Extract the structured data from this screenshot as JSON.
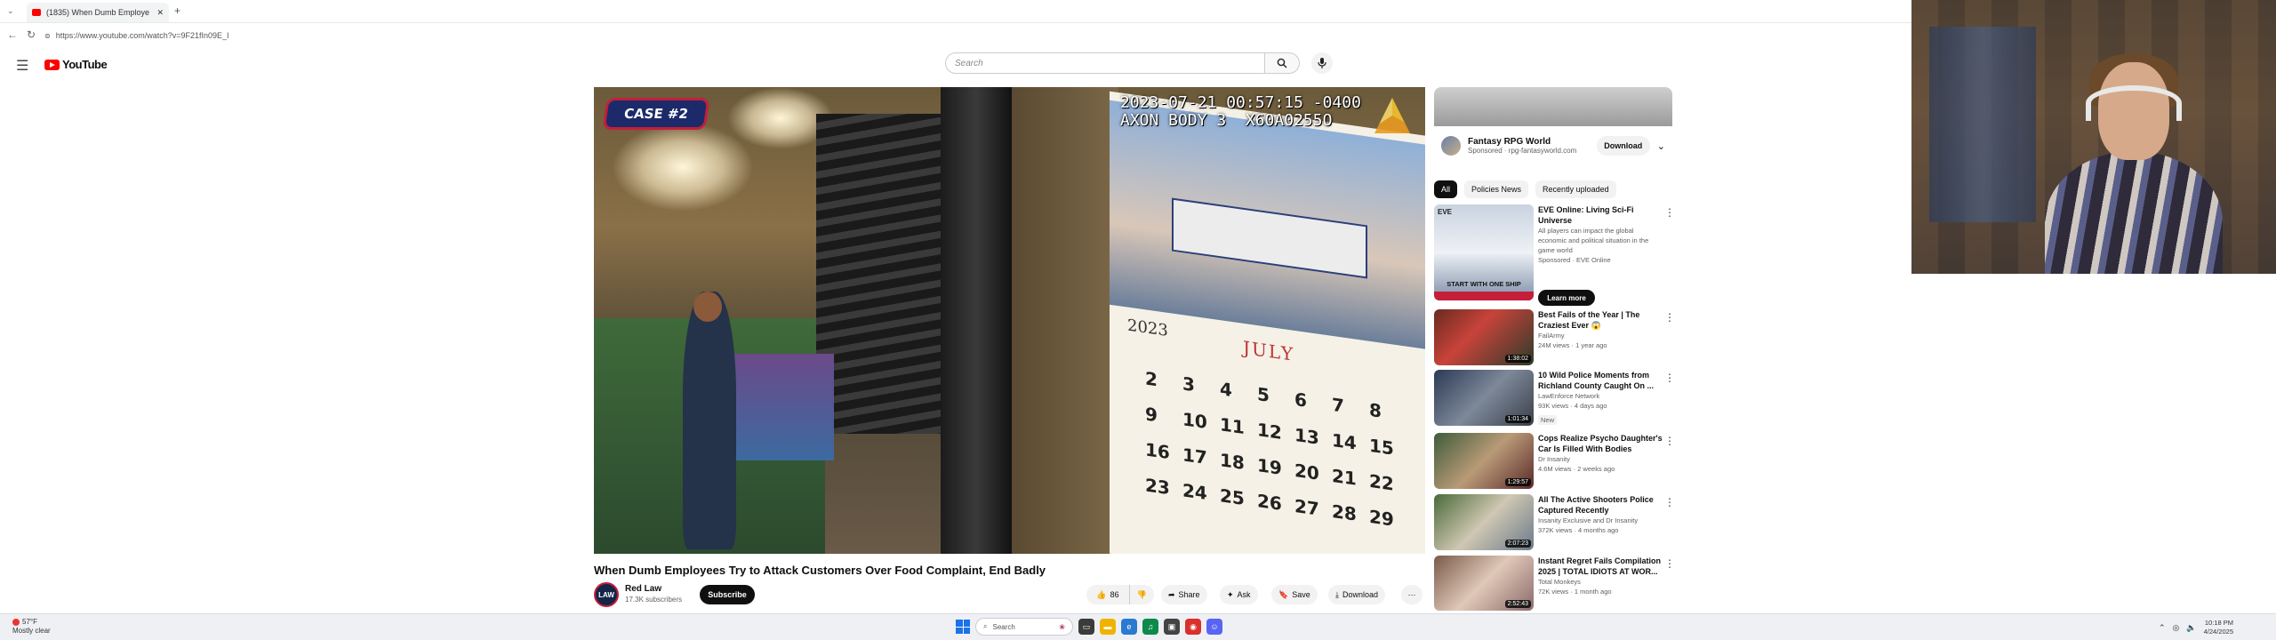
{
  "browser": {
    "tab_title": "(1835) When Dumb Employe",
    "url": "https://www.youtube.com/watch?v=9F21fIn09E_I"
  },
  "header": {
    "logo_text": "YouTube",
    "search_placeholder": "Search"
  },
  "video": {
    "case_badge": "CASE #2",
    "bodycam_line1": "2023-07-21 00:57:15 -0400",
    "bodycam_line2": "AXON BODY 3  X60A0255O",
    "calendar_month": "JULY",
    "calendar_year": "2023",
    "calendar_days": [
      "2",
      "3",
      "4",
      "5",
      "6",
      "7",
      "8",
      "9",
      "10",
      "11",
      "12",
      "13",
      "14",
      "15",
      "16",
      "17",
      "18",
      "19",
      "20",
      "21",
      "22",
      "23",
      "24",
      "25",
      "26",
      "27",
      "28",
      "29"
    ],
    "title": "When Dumb Employees Try to Attack Customers Over Food Complaint, End Badly",
    "channel_name": "Red Law",
    "channel_subs": "17.3K subscribers",
    "channel_avatar_text": "LAW",
    "subscribe_label": "Subscribe",
    "like_count": "86",
    "share_label": "Share",
    "ask_label": "Ask",
    "save_label": "Save",
    "download_label": "Download",
    "more_label": "···"
  },
  "ad": {
    "advertiser": "Fantasy RPG World",
    "sponsored_line": "Sponsored · rpg-fantasyworld.com",
    "download_label": "Download"
  },
  "chips": [
    "All",
    "Policies News",
    "Recently uploaded"
  ],
  "recommendations": [
    {
      "title": "EVE Online: Living Sci-Fi Universe",
      "desc": "All players can impact the global economic and political situation in the game world",
      "meta": "Sponsored · EVE Online",
      "cta": "Learn more",
      "thumb_text": "START WITH ONE SHIP",
      "duration": ""
    },
    {
      "title": "Best Fails of the Year | The Craziest Ever 😱",
      "channel": "FailArmy",
      "meta": "24M views · 1 year ago",
      "duration": "1:38:02"
    },
    {
      "title": "10 Wild Police Moments from Richland County Caught On ...",
      "channel": "LawEnforce Network",
      "meta": "93K views · 4 days ago",
      "badge": "New",
      "duration": "1:01:34"
    },
    {
      "title": "Cops Realize Psycho Daughter's Car Is Filled With Bodies",
      "channel": "Dr Insanity",
      "meta": "4.6M views · 2 weeks ago",
      "duration": "1:29:57"
    },
    {
      "title": "All The Active Shooters Police Captured Recently",
      "channel": "Insanity Exclusive and Dr Insanity",
      "meta": "372K views · 4 months ago",
      "duration": "2:07:23"
    },
    {
      "title": "Instant Regret Fails Compilation 2025 | TOTAL IDIOTS AT WOR...",
      "channel": "Total Monkeys",
      "meta": "72K views · 1 month ago",
      "duration": "2:52:43"
    }
  ],
  "taskbar": {
    "weather_temp": "57°F",
    "weather_desc": "Mostly clear",
    "search_label": "Search",
    "time": "10:18 PM",
    "date": "4/24/2025"
  },
  "colors": {
    "youtube_red": "#ff0000",
    "case_badge_bg": "#1c2a6a",
    "case_badge_border": "#c41e3a"
  }
}
